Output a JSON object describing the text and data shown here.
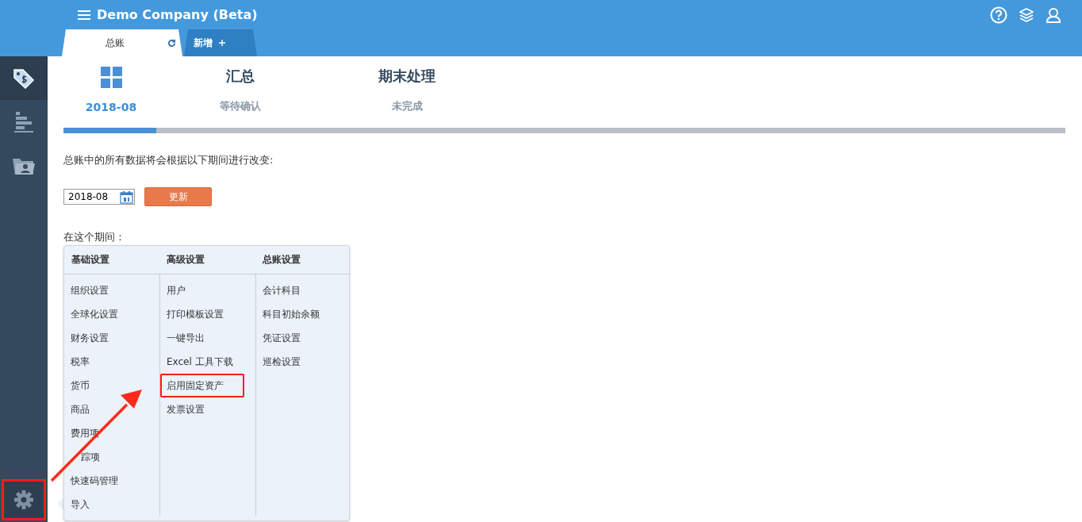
{
  "header": {
    "title": "Demo Company (Beta)"
  },
  "tabs": [
    {
      "label": "总账",
      "selected": true,
      "kind": "page"
    },
    {
      "label": "新增",
      "selected": false,
      "kind": "add"
    }
  ],
  "sidebar": {
    "items": [
      {
        "kind": "tag",
        "selected": true
      },
      {
        "kind": "chart",
        "selected": false
      },
      {
        "kind": "folder",
        "selected": false
      }
    ],
    "settings": {
      "selected": true,
      "highlighted": true
    }
  },
  "steps": [
    {
      "kind": "icon",
      "label": "2018-08",
      "selected": true
    },
    {
      "kind": "text",
      "title": "汇总",
      "label": "等待确认",
      "selected": false
    },
    {
      "kind": "text",
      "title": "期末处理",
      "label": "未完成",
      "selected": false
    }
  ],
  "progress": {
    "level": 0.093
  },
  "intro": "总账中的所有数据将会根据以下期间进行改变:",
  "period_field": {
    "value": "2018-08"
  },
  "update_button": "更新",
  "period_label": "在这个期间：",
  "settings_menu": {
    "columns": [
      {
        "heading": "基础设置",
        "items": [
          {
            "label": "组织设置",
            "highlighted": false
          },
          {
            "label": "全球化设置",
            "highlighted": false
          },
          {
            "label": "财务设置",
            "highlighted": false
          },
          {
            "label": "税率",
            "highlighted": false
          },
          {
            "label": "货币",
            "highlighted": false
          },
          {
            "label": "商品",
            "highlighted": false
          },
          {
            "label": "费用项",
            "highlighted": false
          },
          {
            "label": "踪项",
            "highlighted": false,
            "kind": "covered"
          },
          {
            "label": "快速码管理",
            "highlighted": false
          },
          {
            "label": "导入",
            "highlighted": false
          }
        ]
      },
      {
        "heading": "高级设置",
        "items": [
          {
            "label": "用户",
            "highlighted": false
          },
          {
            "label": "打印模板设置",
            "highlighted": false
          },
          {
            "label": "一键导出",
            "highlighted": false
          },
          {
            "label": "Excel 工具下载",
            "highlighted": false
          },
          {
            "label": "启用固定资产",
            "highlighted": true
          },
          {
            "label": "发票设置",
            "highlighted": false
          }
        ]
      },
      {
        "heading": "总账设置",
        "items": [
          {
            "label": "会计科目",
            "highlighted": false
          },
          {
            "label": "科目初始余额",
            "highlighted": false
          },
          {
            "label": "凭证设置",
            "highlighted": false
          },
          {
            "label": "巡检设置",
            "highlighted": false
          }
        ]
      }
    ]
  }
}
